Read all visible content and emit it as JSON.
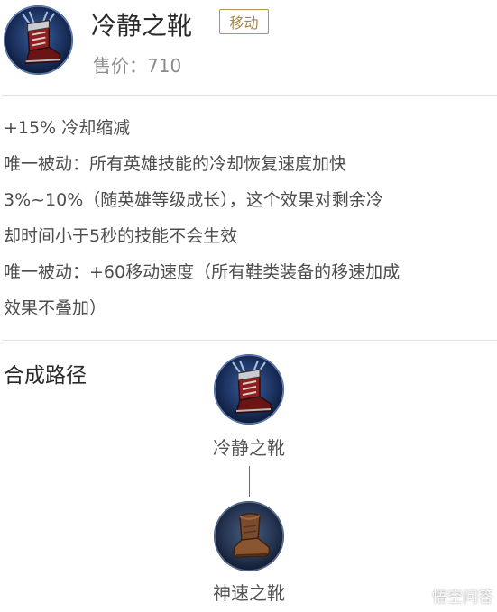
{
  "item": {
    "name": "冷静之靴",
    "tag": "移动",
    "price": "售价：710"
  },
  "description": {
    "lines": [
      "+15% 冷却缩减",
      "唯一被动：所有英雄技能的冷却恢复速度加快",
      "3%~10%（随英雄等级成长），这个效果对剩余冷",
      "却时间小于5秒的技能不会生效",
      "唯一被动：+60移动速度（所有鞋类装备的移速加成",
      "效果不叠加）"
    ]
  },
  "path": {
    "title": "合成路径",
    "nodes": [
      {
        "label": "冷静之靴",
        "icon": "calm-boots-icon"
      },
      {
        "label": "神速之靴",
        "icon": "swift-boots-icon"
      }
    ]
  },
  "watermark": {
    "text": "悟空问答"
  },
  "colors": {
    "tag_border": "#b49653",
    "icon_ring": "#1f3f7a",
    "boot_red": "#8e1f22"
  }
}
